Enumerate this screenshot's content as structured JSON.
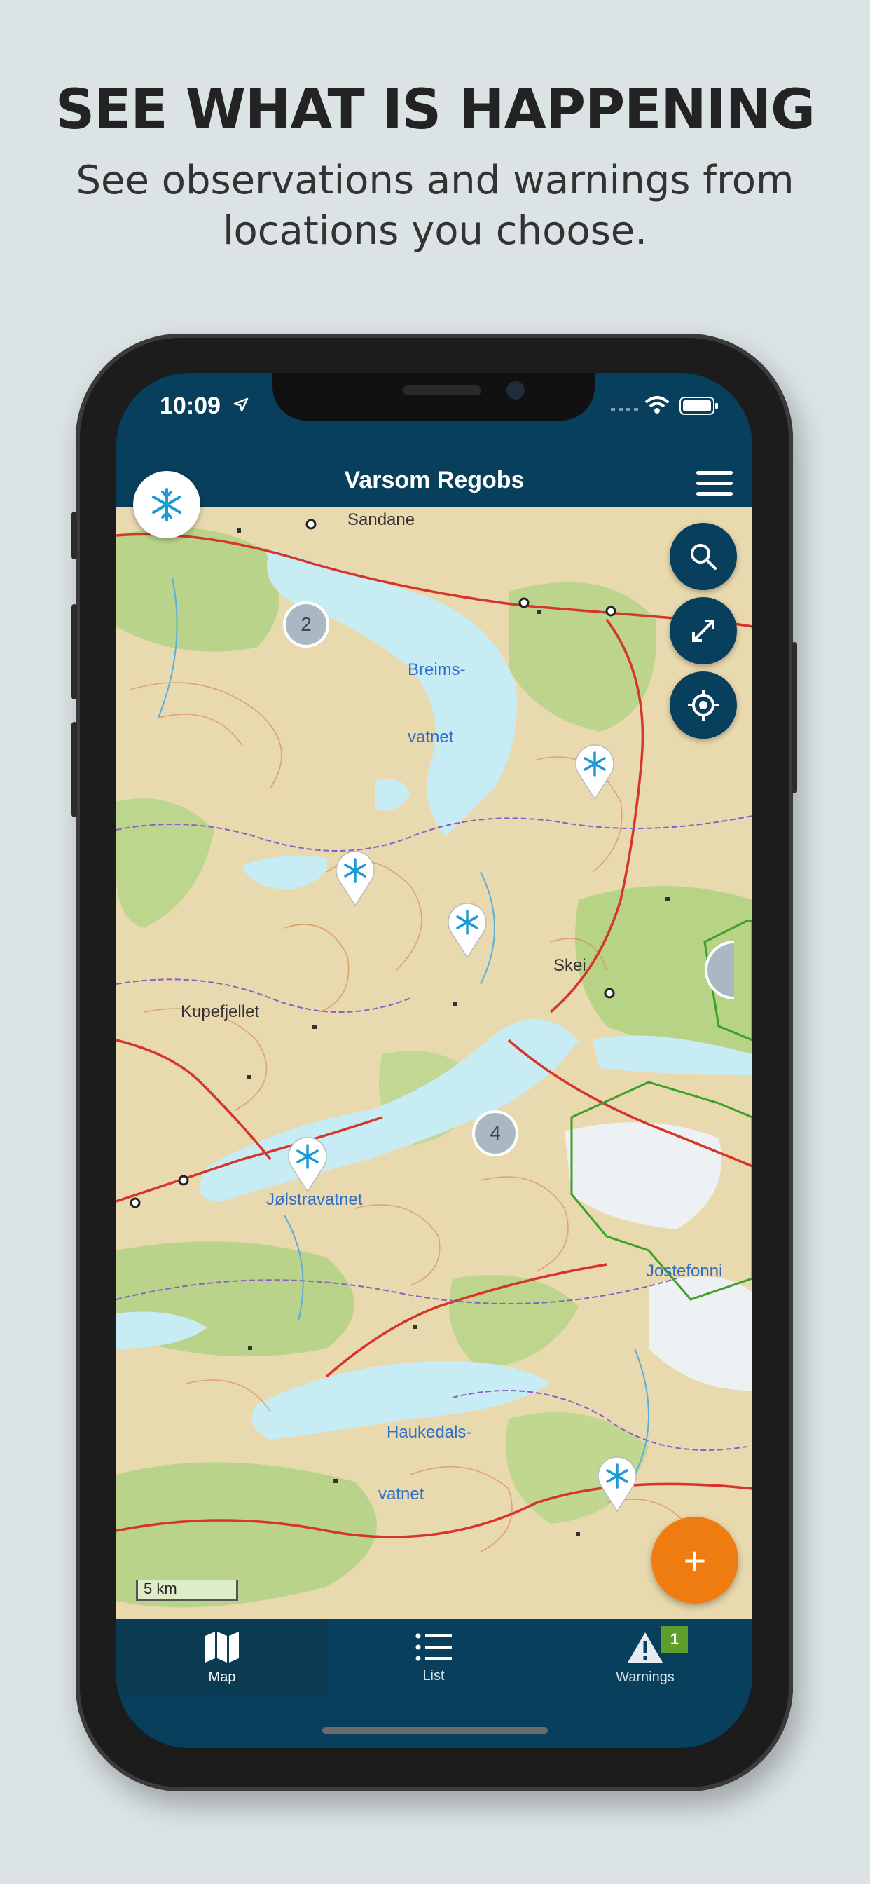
{
  "promo": {
    "headline": "SEE WHAT IS HAPPENING",
    "subline": "See observations and warnings from locations you choose."
  },
  "status_bar": {
    "time": "10:09"
  },
  "header": {
    "title": "Varsom Regobs"
  },
  "map": {
    "place_labels": {
      "sandane": "Sandane",
      "breims1": "Breims-",
      "breims2": "vatnet",
      "skei": "Skei",
      "kupefjellet": "Kupefjellet",
      "jolstravatnet": "Jølstravatnet",
      "jostefonni": "Jostefonni",
      "haukedals1": "Haukedals-",
      "haukedals2": "vatnet"
    },
    "clusters": {
      "cluster_a": "2",
      "cluster_b": "4"
    },
    "scale_label": "5 km",
    "fab_label": "+"
  },
  "tabs": [
    {
      "label": "Map",
      "icon": "map-icon"
    },
    {
      "label": "List",
      "icon": "list-icon"
    },
    {
      "label": "Warnings",
      "icon": "warning-icon",
      "badge": "1"
    }
  ],
  "colors": {
    "app_bar": "#073f5c",
    "fab": "#ef7c11",
    "badge": "#5f9e2b",
    "snow_icon": "#1b9ad6"
  }
}
